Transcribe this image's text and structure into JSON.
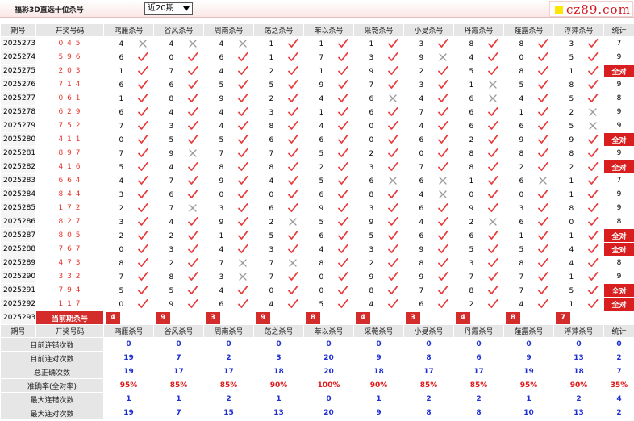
{
  "header": {
    "title": "福彩3D直选十位杀号",
    "period_select": "近20期",
    "logo_text": "cz89.com"
  },
  "columns": {
    "period": "期号",
    "draw": "开奖号码",
    "methods": [
      "鸿雁杀号",
      "谷风杀号",
      "周南杀号",
      "荡之杀号",
      "苯以杀号",
      "采薇杀号",
      "小旻杀号",
      "丹霞杀号",
      "薤露杀号",
      "浮萍杀号"
    ],
    "stat": "统计"
  },
  "rows": [
    {
      "p": "2025273",
      "d": "0 4 5",
      "k": [
        [
          4,
          0
        ],
        [
          4,
          0
        ],
        [
          4,
          0
        ],
        [
          1,
          1
        ],
        [
          1,
          1
        ],
        [
          1,
          1
        ],
        [
          3,
          1
        ],
        [
          8,
          1
        ],
        [
          8,
          1
        ],
        [
          3,
          1
        ]
      ],
      "s": "7"
    },
    {
      "p": "2025274",
      "d": "5 9 6",
      "k": [
        [
          6,
          1
        ],
        [
          0,
          1
        ],
        [
          6,
          1
        ],
        [
          1,
          1
        ],
        [
          7,
          1
        ],
        [
          3,
          1
        ],
        [
          9,
          0
        ],
        [
          4,
          1
        ],
        [
          0,
          1
        ],
        [
          5,
          1
        ]
      ],
      "s": "9"
    },
    {
      "p": "2025275",
      "d": "2 0 3",
      "k": [
        [
          1,
          1
        ],
        [
          7,
          1
        ],
        [
          4,
          1
        ],
        [
          2,
          1
        ],
        [
          1,
          1
        ],
        [
          9,
          1
        ],
        [
          2,
          1
        ],
        [
          5,
          1
        ],
        [
          8,
          1
        ],
        [
          1,
          1
        ]
      ],
      "s": "全对"
    },
    {
      "p": "2025276",
      "d": "7 1 4",
      "k": [
        [
          6,
          1
        ],
        [
          6,
          1
        ],
        [
          5,
          1
        ],
        [
          5,
          1
        ],
        [
          9,
          1
        ],
        [
          7,
          1
        ],
        [
          3,
          1
        ],
        [
          1,
          0
        ],
        [
          5,
          1
        ],
        [
          8,
          1
        ]
      ],
      "s": "9"
    },
    {
      "p": "2025277",
      "d": "0 6 1",
      "k": [
        [
          1,
          1
        ],
        [
          8,
          1
        ],
        [
          9,
          1
        ],
        [
          2,
          1
        ],
        [
          4,
          1
        ],
        [
          6,
          0
        ],
        [
          4,
          1
        ],
        [
          6,
          0
        ],
        [
          4,
          1
        ],
        [
          5,
          1
        ]
      ],
      "s": "8"
    },
    {
      "p": "2025278",
      "d": "6 2 9",
      "k": [
        [
          6,
          1
        ],
        [
          4,
          1
        ],
        [
          4,
          1
        ],
        [
          3,
          1
        ],
        [
          1,
          1
        ],
        [
          6,
          1
        ],
        [
          7,
          1
        ],
        [
          6,
          1
        ],
        [
          1,
          1
        ],
        [
          2,
          0
        ]
      ],
      "s": "9"
    },
    {
      "p": "2025279",
      "d": "7 5 2",
      "k": [
        [
          7,
          1
        ],
        [
          3,
          1
        ],
        [
          4,
          1
        ],
        [
          8,
          1
        ],
        [
          4,
          1
        ],
        [
          0,
          1
        ],
        [
          4,
          1
        ],
        [
          6,
          1
        ],
        [
          6,
          1
        ],
        [
          5,
          0
        ]
      ],
      "s": "9"
    },
    {
      "p": "2025280",
      "d": "4 1 1",
      "k": [
        [
          0,
          1
        ],
        [
          5,
          1
        ],
        [
          5,
          1
        ],
        [
          6,
          1
        ],
        [
          6,
          1
        ],
        [
          0,
          1
        ],
        [
          6,
          1
        ],
        [
          2,
          1
        ],
        [
          9,
          1
        ],
        [
          9,
          1
        ]
      ],
      "s": "全对"
    },
    {
      "p": "2025281",
      "d": "8 9 7",
      "k": [
        [
          7,
          1
        ],
        [
          9,
          0
        ],
        [
          7,
          1
        ],
        [
          7,
          1
        ],
        [
          5,
          1
        ],
        [
          2,
          1
        ],
        [
          0,
          1
        ],
        [
          8,
          1
        ],
        [
          8,
          1
        ],
        [
          8,
          1
        ]
      ],
      "s": "9"
    },
    {
      "p": "2025282",
      "d": "4 1 6",
      "k": [
        [
          5,
          1
        ],
        [
          4,
          1
        ],
        [
          8,
          1
        ],
        [
          8,
          1
        ],
        [
          2,
          1
        ],
        [
          3,
          1
        ],
        [
          7,
          1
        ],
        [
          8,
          1
        ],
        [
          2,
          1
        ],
        [
          2,
          1
        ]
      ],
      "s": "全对"
    },
    {
      "p": "2025283",
      "d": "6 6 4",
      "k": [
        [
          4,
          1
        ],
        [
          7,
          1
        ],
        [
          9,
          1
        ],
        [
          4,
          1
        ],
        [
          5,
          1
        ],
        [
          6,
          0
        ],
        [
          6,
          0
        ],
        [
          1,
          1
        ],
        [
          6,
          0
        ],
        [
          1,
          1
        ]
      ],
      "s": "7"
    },
    {
      "p": "2025284",
      "d": "8 4 4",
      "k": [
        [
          3,
          1
        ],
        [
          6,
          1
        ],
        [
          0,
          1
        ],
        [
          0,
          1
        ],
        [
          6,
          1
        ],
        [
          8,
          1
        ],
        [
          4,
          0
        ],
        [
          0,
          1
        ],
        [
          0,
          1
        ],
        [
          1,
          1
        ]
      ],
      "s": "9"
    },
    {
      "p": "2025285",
      "d": "1 7 2",
      "k": [
        [
          2,
          1
        ],
        [
          7,
          0
        ],
        [
          3,
          1
        ],
        [
          6,
          1
        ],
        [
          9,
          1
        ],
        [
          3,
          1
        ],
        [
          6,
          1
        ],
        [
          9,
          1
        ],
        [
          3,
          1
        ],
        [
          8,
          1
        ]
      ],
      "s": "9"
    },
    {
      "p": "2025286",
      "d": "8 2 7",
      "k": [
        [
          3,
          1
        ],
        [
          4,
          1
        ],
        [
          9,
          1
        ],
        [
          2,
          0
        ],
        [
          5,
          1
        ],
        [
          9,
          1
        ],
        [
          4,
          1
        ],
        [
          2,
          0
        ],
        [
          6,
          1
        ],
        [
          0,
          1
        ]
      ],
      "s": "8"
    },
    {
      "p": "2025287",
      "d": "8 0 5",
      "k": [
        [
          2,
          1
        ],
        [
          2,
          1
        ],
        [
          1,
          1
        ],
        [
          5,
          1
        ],
        [
          6,
          1
        ],
        [
          5,
          1
        ],
        [
          6,
          1
        ],
        [
          6,
          1
        ],
        [
          1,
          1
        ],
        [
          1,
          1
        ]
      ],
      "s": "全对"
    },
    {
      "p": "2025288",
      "d": "7 6 7",
      "k": [
        [
          0,
          1
        ],
        [
          3,
          1
        ],
        [
          4,
          1
        ],
        [
          3,
          1
        ],
        [
          4,
          1
        ],
        [
          3,
          1
        ],
        [
          9,
          1
        ],
        [
          5,
          1
        ],
        [
          5,
          1
        ],
        [
          4,
          1
        ]
      ],
      "s": "全对"
    },
    {
      "p": "2025289",
      "d": "4 7 3",
      "k": [
        [
          8,
          1
        ],
        [
          2,
          1
        ],
        [
          7,
          0
        ],
        [
          7,
          0
        ],
        [
          8,
          1
        ],
        [
          2,
          1
        ],
        [
          8,
          1
        ],
        [
          3,
          1
        ],
        [
          8,
          1
        ],
        [
          4,
          1
        ]
      ],
      "s": "8"
    },
    {
      "p": "2025290",
      "d": "3 3 2",
      "k": [
        [
          7,
          1
        ],
        [
          8,
          1
        ],
        [
          3,
          0
        ],
        [
          7,
          1
        ],
        [
          0,
          1
        ],
        [
          9,
          1
        ],
        [
          9,
          1
        ],
        [
          7,
          1
        ],
        [
          7,
          1
        ],
        [
          1,
          1
        ]
      ],
      "s": "9"
    },
    {
      "p": "2025291",
      "d": "7 9 4",
      "k": [
        [
          5,
          1
        ],
        [
          5,
          1
        ],
        [
          4,
          1
        ],
        [
          0,
          1
        ],
        [
          0,
          1
        ],
        [
          8,
          1
        ],
        [
          7,
          1
        ],
        [
          8,
          1
        ],
        [
          7,
          1
        ],
        [
          5,
          1
        ]
      ],
      "s": "全对"
    },
    {
      "p": "2025292",
      "d": "1 1 7",
      "k": [
        [
          0,
          1
        ],
        [
          9,
          1
        ],
        [
          6,
          1
        ],
        [
          4,
          1
        ],
        [
          5,
          1
        ],
        [
          4,
          1
        ],
        [
          6,
          1
        ],
        [
          2,
          1
        ],
        [
          4,
          1
        ],
        [
          1,
          1
        ]
      ],
      "s": "全对"
    }
  ],
  "current": {
    "period": "2025293",
    "label": "当前期杀号",
    "kills": [
      "4",
      "9",
      "3",
      "9",
      "8",
      "4",
      "3",
      "4",
      "8",
      "7"
    ]
  },
  "stats": [
    {
      "label": "目前连错次数",
      "v": [
        "0",
        "0",
        "0",
        "0",
        "0",
        "0",
        "0",
        "0",
        "0",
        "0"
      ],
      "last": "0",
      "style": "blue"
    },
    {
      "label": "目前连对次数",
      "v": [
        "19",
        "7",
        "2",
        "3",
        "20",
        "9",
        "8",
        "6",
        "9",
        "13"
      ],
      "last": "2",
      "style": "blue"
    },
    {
      "label": "总正确次数",
      "v": [
        "19",
        "17",
        "17",
        "18",
        "20",
        "18",
        "17",
        "17",
        "19",
        "18"
      ],
      "last": "7",
      "style": "blue"
    },
    {
      "label": "准确率(全对率)",
      "v": [
        "95%",
        "85%",
        "85%",
        "90%",
        "100%",
        "90%",
        "85%",
        "85%",
        "95%",
        "90%"
      ],
      "last": "35%",
      "style": "red"
    },
    {
      "label": "最大连错次数",
      "v": [
        "1",
        "1",
        "2",
        "1",
        "0",
        "1",
        "2",
        "2",
        "1",
        "2"
      ],
      "last": "4",
      "style": "blue"
    },
    {
      "label": "最大连对次数",
      "v": [
        "19",
        "7",
        "15",
        "13",
        "20",
        "9",
        "8",
        "8",
        "10",
        "13"
      ],
      "last": "2",
      "style": "blue"
    }
  ],
  "colors": {
    "check": "#e83a3a",
    "cross": "#9a9a9a",
    "accent": "#d42b2b",
    "stat_blue": "#1d2fd3"
  }
}
